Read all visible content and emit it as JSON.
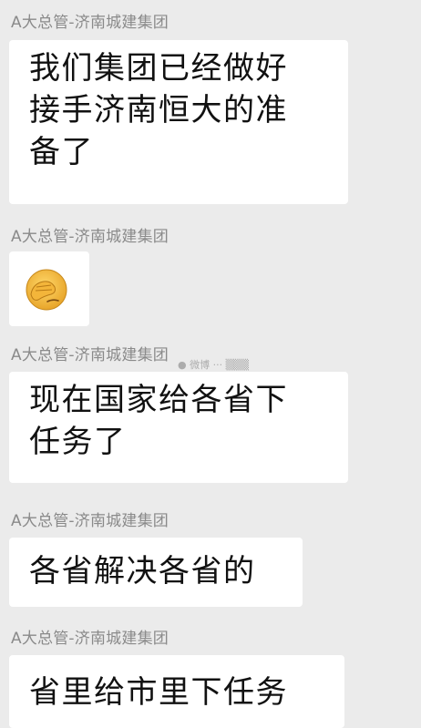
{
  "messages": [
    {
      "sender": "A大总管-济南城建集团",
      "type": "text",
      "lines": [
        "我们集团已经做好",
        "接手济南恒大的准",
        "备了"
      ]
    },
    {
      "sender": "A大总管-济南城建集团",
      "type": "emoji",
      "emoji": "facepalm-emoji"
    },
    {
      "sender": "A大总管-济南城建集团",
      "type": "text",
      "lines": [
        "现在国家给各省下",
        "任务了"
      ]
    },
    {
      "sender": "A大总管-济南城建集团",
      "type": "text",
      "lines": [
        "各省解决各省的"
      ]
    },
    {
      "sender": "A大总管-济南城建集团",
      "type": "text",
      "lines": [
        "省里给市里下任务"
      ]
    }
  ],
  "colors": {
    "background": "#ebebeb",
    "bubble": "#ffffff",
    "sender_text": "#8a8a8a",
    "message_text": "#111111",
    "emoji_face": "#f5c040"
  }
}
